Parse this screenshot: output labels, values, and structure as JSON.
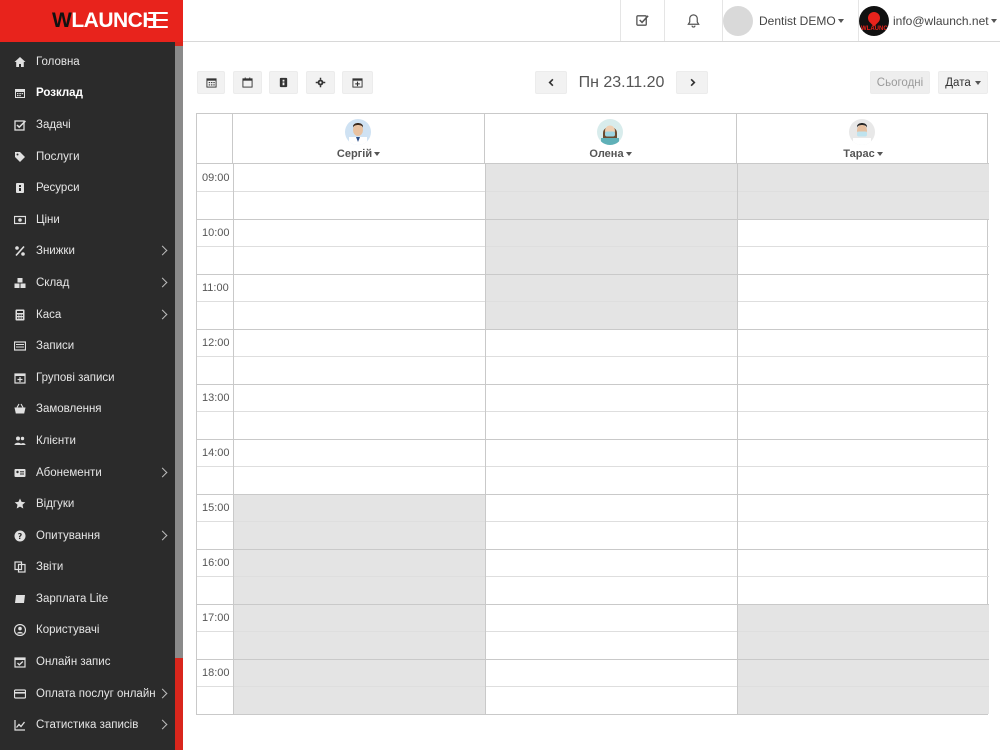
{
  "brand": {
    "logo_w": "W",
    "logo_rest": "LAUNCH"
  },
  "sidebar": {
    "items": [
      {
        "label": "Головна",
        "icon": "home-icon",
        "active": false,
        "sub": false
      },
      {
        "label": "Розклад",
        "icon": "calendar-icon",
        "active": true,
        "sub": false
      },
      {
        "label": "Задачі",
        "icon": "checkbox-icon",
        "active": false,
        "sub": false
      },
      {
        "label": "Послуги",
        "icon": "tags-icon",
        "active": false,
        "sub": false
      },
      {
        "label": "Ресурси",
        "icon": "resource-icon",
        "active": false,
        "sub": false
      },
      {
        "label": "Ціни",
        "icon": "money-icon",
        "active": false,
        "sub": false
      },
      {
        "label": "Знижки",
        "icon": "percent-icon",
        "active": false,
        "sub": true
      },
      {
        "label": "Склад",
        "icon": "boxes-icon",
        "active": false,
        "sub": true
      },
      {
        "label": "Каса",
        "icon": "calculator-icon",
        "active": false,
        "sub": true
      },
      {
        "label": "Записи",
        "icon": "list-icon",
        "active": false,
        "sub": false
      },
      {
        "label": "Групові записи",
        "icon": "calendar-plus-icon",
        "active": false,
        "sub": false
      },
      {
        "label": "Замовлення",
        "icon": "basket-icon",
        "active": false,
        "sub": false
      },
      {
        "label": "Клієнти",
        "icon": "users-icon",
        "active": false,
        "sub": false
      },
      {
        "label": "Абонементи",
        "icon": "id-card-icon",
        "active": false,
        "sub": true
      },
      {
        "label": "Відгуки",
        "icon": "star-icon",
        "active": false,
        "sub": false
      },
      {
        "label": "Опитування",
        "icon": "question-icon",
        "active": false,
        "sub": true
      },
      {
        "label": "Звіти",
        "icon": "copy-icon",
        "active": false,
        "sub": false
      },
      {
        "label": "Зарплата Lite",
        "icon": "money-bill-icon",
        "active": false,
        "sub": false
      },
      {
        "label": "Користувачі",
        "icon": "user-circle-icon",
        "active": false,
        "sub": false
      },
      {
        "label": "Онлайн запис",
        "icon": "calendar-check-icon",
        "active": false,
        "sub": false
      },
      {
        "label": "Оплата послуг онлайн",
        "icon": "credit-card-icon",
        "active": false,
        "sub": true
      },
      {
        "label": "Статистика записів",
        "icon": "line-chart-icon",
        "active": false,
        "sub": true
      }
    ]
  },
  "topbar": {
    "company": "Dentist DEMO",
    "user_email": "info@wlaunch.net"
  },
  "toolbar": {
    "current_date": "Пн 23.11.20",
    "today_label": "Сьогодні",
    "date_label": "Дата"
  },
  "schedule": {
    "staff": [
      {
        "name": "Сергій",
        "avatar": "male-doctor-avatar"
      },
      {
        "name": "Олена",
        "avatar": "female-doctor-avatar"
      },
      {
        "name": "Тарас",
        "avatar": "male-doctor-masked-avatar"
      }
    ],
    "hours": [
      "09:00",
      "10:00",
      "11:00",
      "12:00",
      "13:00",
      "14:00",
      "15:00",
      "16:00",
      "17:00",
      "18:00"
    ]
  },
  "colors": {
    "brand_red": "#e8231c",
    "sidebar_bg": "#2b2b2b",
    "blocked_cell": "#e4e4e4"
  }
}
